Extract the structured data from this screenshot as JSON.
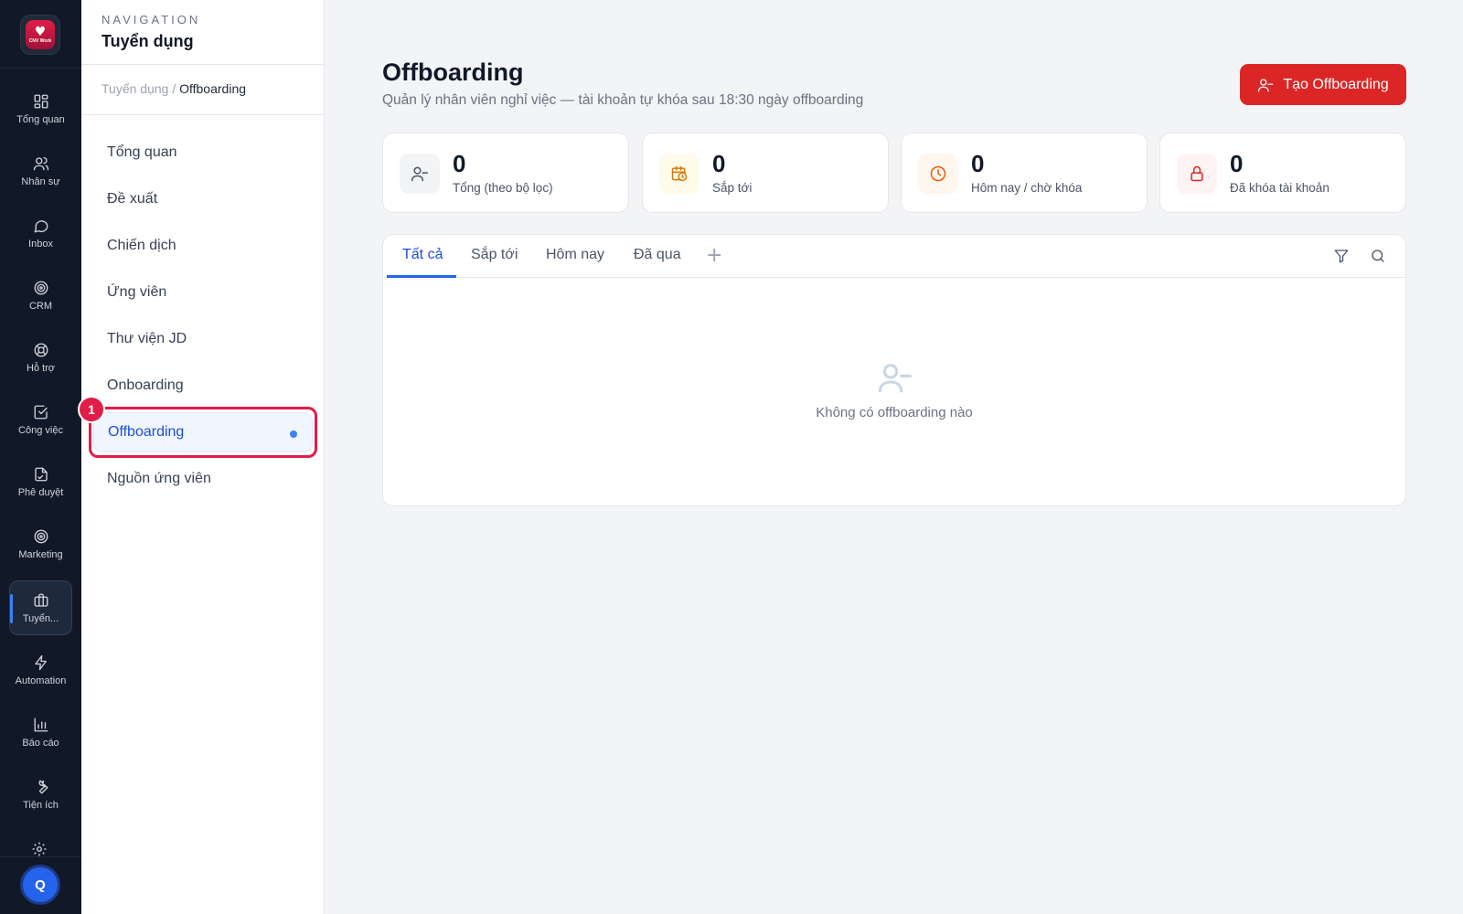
{
  "logo": {
    "brand_text": "CNV Work"
  },
  "rail": {
    "items": [
      {
        "label": "Tổng quan",
        "icon": "dashboard-grid-icon"
      },
      {
        "label": "Nhân sự",
        "icon": "users-icon"
      },
      {
        "label": "Inbox",
        "icon": "chat-bubble-icon"
      },
      {
        "label": "CRM",
        "icon": "target-icon"
      },
      {
        "label": "Hỗ trợ",
        "icon": "lifebuoy-icon"
      },
      {
        "label": "Công việc",
        "icon": "checkbox-icon"
      },
      {
        "label": "Phê duyệt",
        "icon": "document-sign-icon"
      },
      {
        "label": "Marketing",
        "icon": "target-icon"
      },
      {
        "label": "Tuyển...",
        "icon": "briefcase-icon"
      },
      {
        "label": "Automation",
        "icon": "lightning-icon"
      },
      {
        "label": "Báo cáo",
        "icon": "bar-chart-icon"
      },
      {
        "label": "Tiện ích",
        "icon": "wrench-icon"
      }
    ],
    "avatar_initial": "Q"
  },
  "subnav": {
    "heading": "NAVIGATION",
    "title": "Tuyển dụng",
    "breadcrumb": {
      "parent": "Tuyển dụng",
      "separator": "/",
      "current": "Offboarding"
    },
    "items": [
      {
        "label": "Tổng quan"
      },
      {
        "label": "Đề xuất"
      },
      {
        "label": "Chiến dịch"
      },
      {
        "label": "Ứng viên"
      },
      {
        "label": "Thư viện JD"
      },
      {
        "label": "Onboarding"
      },
      {
        "label": "Offboarding"
      },
      {
        "label": "Nguồn ứng viên"
      }
    ],
    "step_badge": "1"
  },
  "header": {
    "title": "Offboarding",
    "subtitle": "Quản lý nhân viên nghỉ việc — tài khoản tự khóa sau 18:30 ngày offboarding",
    "create_button": "Tạo Offboarding"
  },
  "stats": [
    {
      "value": "0",
      "label": "Tổng (theo bộ lọc)",
      "icon": "user-minus-icon",
      "color": "#4b5563",
      "bg": "#f3f4f6"
    },
    {
      "value": "0",
      "label": "Sắp tới",
      "icon": "calendar-clock-icon",
      "color": "#d97706",
      "bg": "#fffbeb"
    },
    {
      "value": "0",
      "label": "Hôm nay / chờ khóa",
      "icon": "clock-icon",
      "color": "#ea580c",
      "bg": "#fff7ed"
    },
    {
      "value": "0",
      "label": "Đã khóa tài khoản",
      "icon": "lock-icon",
      "color": "#dc2626",
      "bg": "#fef2f2"
    }
  ],
  "tabs": [
    {
      "label": "Tất cả"
    },
    {
      "label": "Sắp tới"
    },
    {
      "label": "Hôm nay"
    },
    {
      "label": "Đã qua"
    }
  ],
  "tab_add": "+",
  "empty_state": {
    "text": "Không có offboarding nào"
  },
  "colors": {
    "accent": "#2563eb",
    "primary_button": "#dc2626",
    "rail_bg": "#111827"
  }
}
